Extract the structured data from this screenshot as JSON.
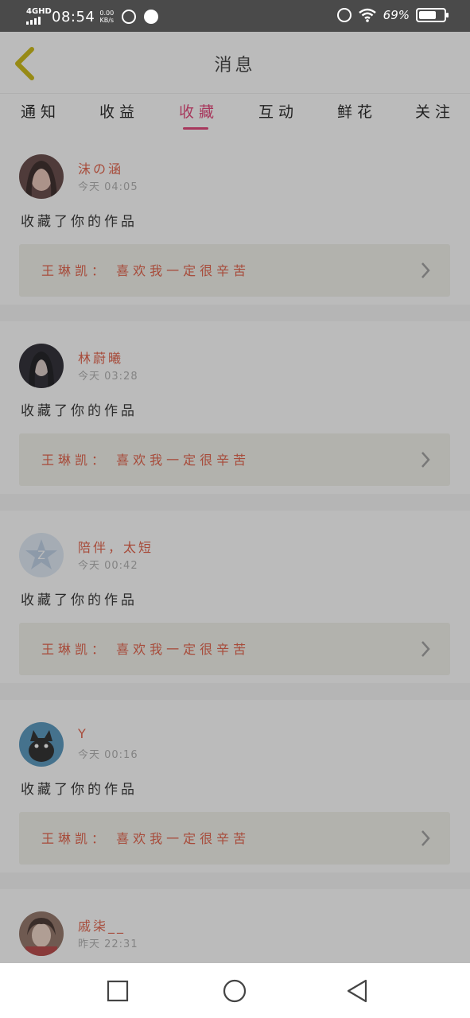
{
  "status_bar": {
    "network": "4GHD",
    "time": "08:54",
    "speed_value": "0.00",
    "speed_unit": "KB/s",
    "battery_percent": "69%",
    "battery_level": 0.69
  },
  "header": {
    "title": "消息",
    "back_icon": "chevron-left-icon"
  },
  "tabs": [
    {
      "label": "通知"
    },
    {
      "label": "收益"
    },
    {
      "label": "收藏",
      "active": true
    },
    {
      "label": "互动"
    },
    {
      "label": "鲜花"
    },
    {
      "label": "关注"
    }
  ],
  "messages": [
    {
      "name": "沫の涵",
      "time": "今天 04:05",
      "action": "收藏了你的作品",
      "quote": "王琳凯：  喜欢我一定很辛苦"
    },
    {
      "name": "林蔚曦",
      "time": "今天 03:28",
      "action": "收藏了你的作品",
      "quote": "王琳凯：  喜欢我一定很辛苦"
    },
    {
      "name": "陪伴，太短",
      "time": "今天 00:42",
      "action": "收藏了你的作品",
      "quote": "王琳凯：  喜欢我一定很辛苦"
    },
    {
      "name": "Y",
      "time": "今天 00:16",
      "action": "收藏了你的作品",
      "quote": "王琳凯：  喜欢我一定很辛苦"
    },
    {
      "name": "戚柒__",
      "time": "昨天 22:31"
    }
  ],
  "colors": {
    "accent": "#e0356d",
    "name": "#e0543a",
    "quote_bg": "#f2f2ea",
    "back_chevron": "#c8b400"
  }
}
